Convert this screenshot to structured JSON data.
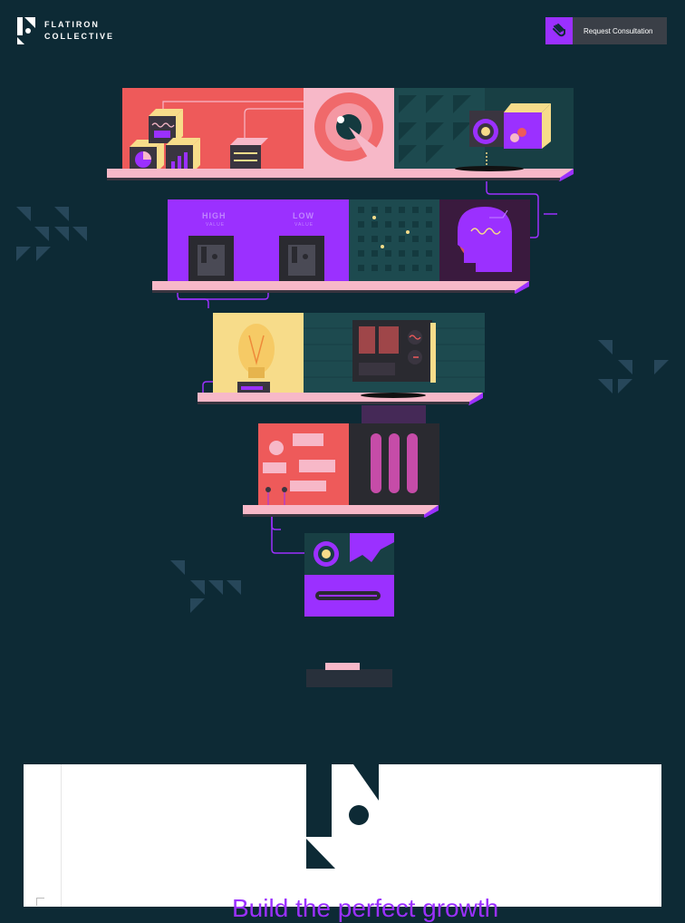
{
  "brand": {
    "line1": "FLATIRON",
    "line2": "COLLECTIVE"
  },
  "header": {
    "cta_label": "Request Consultation"
  },
  "illustration": {
    "high_label": "HIGH",
    "high_sub": "VALUE",
    "low_label": "LOW",
    "low_sub": "VALUE"
  },
  "hero": {
    "headline": "Build the perfect growth"
  },
  "colors": {
    "background": "#0d2a35",
    "accent": "#9b30ff",
    "coral": "#ee5a5a",
    "pink": "#f7b8c8",
    "yellow": "#f7dc8a",
    "teal": "#1d4a4f"
  }
}
